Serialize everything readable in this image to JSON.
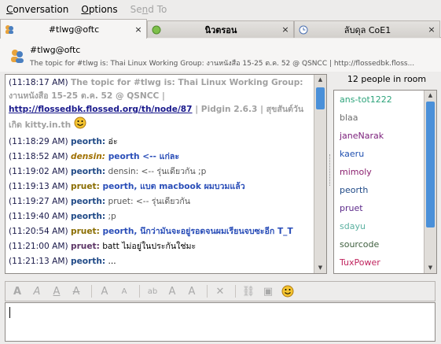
{
  "menu": {
    "conversation": "Conversation",
    "options": "Options",
    "send_to": "Send To"
  },
  "tabs": [
    {
      "label": "#tlwg@oftc",
      "close": "×",
      "active": true
    },
    {
      "label": "นิวตรอน",
      "close": "×",
      "active": false
    },
    {
      "label": "ลับดุล CoE1",
      "close": "×",
      "active": false
    }
  ],
  "header": {
    "room": "#tlwg@oftc",
    "topic": "The topic for #tlwg is: Thai Linux Working Group: งานหนังสือ 15-25 ต.ค. 52 @ QSNCC | http://flossedbk.floss..."
  },
  "messages": [
    {
      "ts": "(11:18:17 AM)",
      "nick": "",
      "text": "The topic for #tlwg is: Thai Linux Working Group: งานหนังสือ 15-25 ต.ค. 52 @ QSNCC | ",
      "link": "http://flossedbk.flossed.org/th/node/87",
      "tail": " | Pidgin 2.6.3 | สุขสันต์วันเกิด kitty.in.th",
      "system": true,
      "nick_color": "#000",
      "text_color": "#a0a0a0",
      "bold": true
    },
    {
      "ts": "(11:18:29 AM)",
      "nick": "peorth:",
      "text": " อ่ะ",
      "nick_color": "#204a87",
      "text_color": "#000",
      "bold": false
    },
    {
      "ts": "(11:18:52 AM)",
      "nick": "densin:",
      "text": " peorth <-- แก่ละ",
      "nick_color": "#a07000",
      "text_color": "#2a4eb8",
      "bold": true,
      "italic": true,
      "highlight": true
    },
    {
      "ts": "(11:19:02 AM)",
      "nick": "peorth:",
      "text": " densin: <-- รุ่นเดียวกัน ;p",
      "nick_color": "#204a87",
      "text_color": "#555",
      "bold": false
    },
    {
      "ts": "(11:19:13 AM)",
      "nick": "pruet:",
      "text": " peorth, แบต macbook ผมบวมแล้ว",
      "nick_color": "#8a6d00",
      "text_color": "#2a4eb8",
      "bold": true,
      "highlight": true
    },
    {
      "ts": "(11:19:27 AM)",
      "nick": "peorth:",
      "text": " pruet: <-- รุ่นเดียวกัน",
      "nick_color": "#204a87",
      "text_color": "#555",
      "bold": false
    },
    {
      "ts": "(11:19:40 AM)",
      "nick": "peorth:",
      "text": " ;p",
      "nick_color": "#204a87",
      "text_color": "#555",
      "bold": false
    },
    {
      "ts": "(11:20:54 AM)",
      "nick": "pruet:",
      "text": " peorth, นึกว่ามันจะอยู่รอดจนผมเรียนจบซะอีก T_T",
      "nick_color": "#8a6d00",
      "text_color": "#2a4eb8",
      "bold": true,
      "highlight": true
    },
    {
      "ts": "(11:21:00 AM)",
      "nick": "pruet:",
      "text": " batt ไม่อยู่ในประกันใช่มะ",
      "nick_color": "#5c3566",
      "text_color": "#000",
      "bold": false
    },
    {
      "ts": "(11:21:13 AM)",
      "nick": "peorth:",
      "text": " ...",
      "nick_color": "#204a87",
      "text_color": "#000",
      "bold": false
    }
  ],
  "userlist": {
    "count_label": "12 people in room",
    "users": [
      {
        "name": "ans-tot1222",
        "color": "#2ca37a"
      },
      {
        "name": "blaa",
        "color": "#6e6e6e"
      },
      {
        "name": "janeNarak",
        "color": "#7a1d7a"
      },
      {
        "name": "kaeru",
        "color": "#2050b0"
      },
      {
        "name": "mimoly",
        "color": "#8a1f6e"
      },
      {
        "name": "peorth",
        "color": "#204a87"
      },
      {
        "name": "pruet",
        "color": "#5c2a8a"
      },
      {
        "name": "sdayu",
        "color": "#5ab0a0"
      },
      {
        "name": "sourcode",
        "color": "#406040"
      },
      {
        "name": "TuxPower",
        "color": "#c0245e"
      }
    ]
  },
  "toolbar": {
    "buttons": [
      "bold-icon",
      "italic-icon",
      "underline-icon",
      "strike-icon",
      "sep",
      "grow-font-icon",
      "shrink-font-icon",
      "sep",
      "font-icon",
      "fg-color-icon",
      "bg-color-icon",
      "sep",
      "clear-format-icon",
      "sep",
      "link-icon",
      "image-icon",
      "smiley-icon"
    ]
  }
}
